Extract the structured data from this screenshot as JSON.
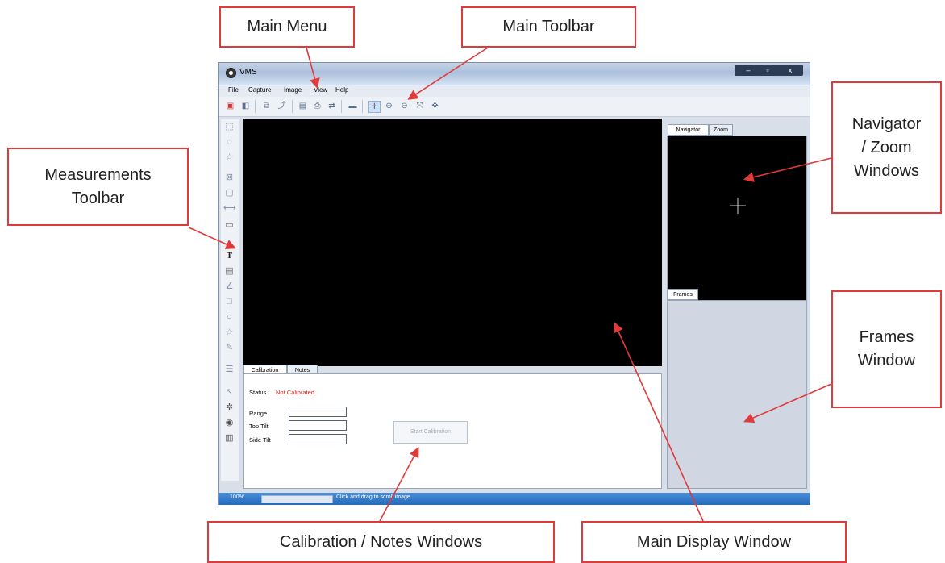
{
  "callouts": {
    "main_menu": "Main Menu",
    "main_toolbar": "Main Toolbar",
    "measurements_toolbar": "Measurements\nToolbar",
    "navigator_zoom": "Navigator\n/ Zoom\nWindows",
    "frames_window": "Frames\nWindow",
    "calibration_notes": "Calibration / Notes Windows",
    "main_display": "Main Display Window"
  },
  "app": {
    "title": "VMS",
    "window_controls": [
      "–",
      "▫",
      "x"
    ],
    "menu": [
      "File",
      "Capture",
      "Image",
      "View",
      "Help"
    ],
    "toolbar_icons": [
      "new-icon",
      "open-icon",
      "copy-icon",
      "export-icon",
      "print-preview-icon",
      "print-icon",
      "page-setup-icon",
      "camera-icon",
      "pan-icon",
      "zoom-in-icon",
      "zoom-out-icon",
      "fit-icon",
      "navigate-icon"
    ],
    "measurement_icons": [
      "rect-select-icon",
      "ellipse-select-icon",
      "polygon-select-icon",
      "box-icon",
      "square-icon",
      "line-icon",
      "ruler-icon",
      "text-icon",
      "scale-icon",
      "angle-icon",
      "rectangle-icon",
      "circle-icon",
      "polygon-icon",
      "freehand-icon",
      "list-icon",
      "pointer-icon",
      "settings-icon",
      "eye-icon",
      "delete-icon"
    ],
    "toolbar_glyphs": [
      "▣",
      "◧",
      "⧉",
      "⤴",
      "▤",
      "⎙",
      "⇄",
      "▬",
      "✛",
      "⊕",
      "⊖",
      "⤧",
      "✥"
    ],
    "measure_glyphs": [
      "⬚",
      "◌",
      "☆",
      "⊠",
      "▢",
      "⟷",
      "▭",
      "T",
      "▤",
      "∠",
      "□",
      "○",
      "☆",
      "✎",
      "☰",
      "↖",
      "✲",
      "◉",
      "▥"
    ],
    "navigator_tabs": [
      "Navigator",
      "Zoom"
    ],
    "frames_tab": "Frames",
    "calibration_tabs": [
      "Calibration",
      "Notes"
    ],
    "status_label": "Status",
    "status_value": "Not Calibrated",
    "range_label": "Range",
    "top_tilt_label": "Top Tilt",
    "side_tilt_label": "Side Tilt",
    "start_calibration": "Start Calibration",
    "zoom_level": "100%",
    "status_hint": "Click and drag to scroll image."
  },
  "colors": {
    "annotation_red": "#e03a3a",
    "not_calibrated": "#e02020",
    "frames_background": "#d1d6e3",
    "statusbar_blue": "#2f79cc"
  }
}
